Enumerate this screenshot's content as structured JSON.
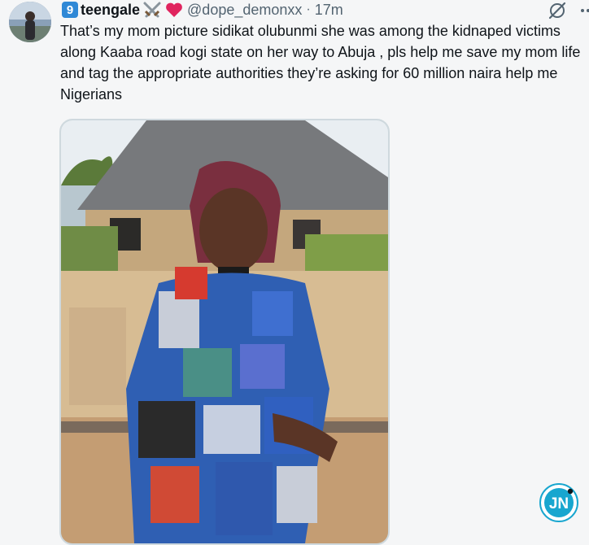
{
  "post": {
    "number_badge": "9",
    "display_name": "teengale",
    "name_emoji_icons": [
      "crossed-swords-icon",
      "red-heart-icon"
    ],
    "handle": "@dope_demonxx",
    "separator": "·",
    "time": "17m",
    "text": "That’s my mom picture sidikat olubunmi she was among the kidnaped victims along Kaaba road kogi state on her way to Abuja , pls help me save my mom life and tag the appropriate authorities they’re asking for 60 million naira help me Nigerians"
  },
  "icons": {
    "grok": "grok-icon",
    "more": "more-icon"
  },
  "watermark": {
    "logo_text": "JN"
  },
  "colors": {
    "badge_blue": "#2f88d6",
    "text_primary": "#0f1419",
    "text_secondary": "#536471",
    "media_border": "#cfd9de"
  }
}
